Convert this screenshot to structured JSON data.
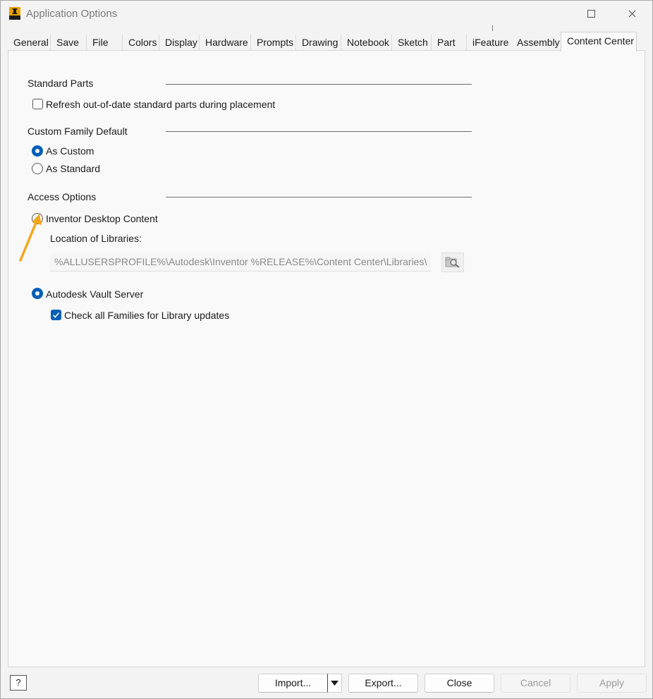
{
  "window": {
    "title": "Application Options",
    "accent": "#005fb8",
    "arrow_color": "#f4a71d"
  },
  "tabs": [
    {
      "label": "General"
    },
    {
      "label": "Save"
    },
    {
      "label": "File"
    },
    {
      "label": "Colors"
    },
    {
      "label": "Display"
    },
    {
      "label": "Hardware"
    },
    {
      "label": "Prompts"
    },
    {
      "label": "Drawing"
    },
    {
      "label": "Notebook"
    },
    {
      "label": "Sketch"
    },
    {
      "label": "Part"
    },
    {
      "label": "iFeature"
    },
    {
      "label": "Assembly"
    },
    {
      "label": "Content Center"
    }
  ],
  "active_tab": "Content Center",
  "standard_parts": {
    "heading": "Standard Parts",
    "refresh_label": "Refresh out-of-date standard parts during placement",
    "refresh_checked": false
  },
  "custom_family": {
    "heading": "Custom Family Default",
    "options": [
      {
        "label": "As Custom",
        "selected": true
      },
      {
        "label": "As Standard",
        "selected": false
      }
    ]
  },
  "access_options": {
    "heading": "Access Options",
    "desktop_label": "Inventor Desktop Content",
    "desktop_selected": false,
    "location_label": "Location of Libraries:",
    "location_value": "%ALLUSERSPROFILE%\\Autodesk\\Inventor %RELEASE%\\Content Center\\Libraries\\",
    "vault_label": "Autodesk Vault Server",
    "vault_selected": true,
    "check_families_label": "Check all Families for Library updates",
    "check_families_checked": true
  },
  "buttons": {
    "help": "?",
    "import": "Import...",
    "export": "Export...",
    "close": "Close",
    "cancel": "Cancel",
    "apply": "Apply"
  },
  "icons": {
    "app": "inventor-pro-icon",
    "browse": "folder-search-icon",
    "annotation": "orange-arrow-icon"
  }
}
